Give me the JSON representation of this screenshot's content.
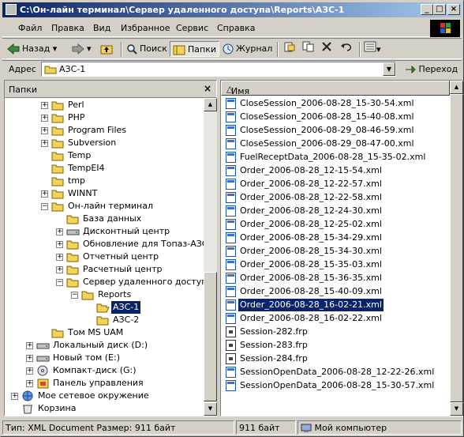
{
  "window": {
    "title": "C:\\Он-лайн терминал\\Сервер удаленного доступа\\Reports\\АЗС-1",
    "minimize": "_",
    "maximize": "□",
    "close": "×"
  },
  "menu": {
    "items": [
      "Файл",
      "Правка",
      "Вид",
      "Избранное",
      "Сервис",
      "Справка"
    ]
  },
  "toolbar": {
    "back": "Назад",
    "forward": "",
    "search": "Поиск",
    "folders": "Папки",
    "history": "Журнал"
  },
  "address": {
    "label": "Адрес",
    "value": "АЗС-1",
    "go": "Переход"
  },
  "folders_pane": {
    "title": "Папки",
    "close": "×",
    "tree": [
      {
        "label": "Perl",
        "level": 3,
        "expander": "+"
      },
      {
        "label": "PHP",
        "level": 3,
        "expander": "+"
      },
      {
        "label": "Program Files",
        "level": 3,
        "expander": "+"
      },
      {
        "label": "Subversion",
        "level": 3,
        "expander": "+"
      },
      {
        "label": "Temp",
        "level": 3,
        "expander": ""
      },
      {
        "label": "TempEI4",
        "level": 3,
        "expander": ""
      },
      {
        "label": "tmp",
        "level": 3,
        "expander": ""
      },
      {
        "label": "WINNT",
        "level": 3,
        "expander": "+"
      },
      {
        "label": "Он-лайн терминал",
        "level": 3,
        "expander": "-"
      },
      {
        "label": "База данных",
        "level": 4,
        "expander": ""
      },
      {
        "label": "Дисконтный центр",
        "level": 4,
        "expander": "+"
      },
      {
        "label": "Обновление для Топаз-АЗС",
        "level": 4,
        "expander": "+"
      },
      {
        "label": "Отчетный центр",
        "level": 4,
        "expander": "+"
      },
      {
        "label": "Расчетный центр",
        "level": 4,
        "expander": "+"
      },
      {
        "label": "Сервер удаленного доступа",
        "level": 4,
        "expander": "-"
      },
      {
        "label": "Reports",
        "level": 5,
        "expander": "-"
      },
      {
        "label": "АЗС-1",
        "level": 6,
        "expander": ""
      },
      {
        "label": "АЗС-2",
        "level": 6,
        "expander": ""
      },
      {
        "label": "Том MS UAM",
        "level": 3,
        "expander": ""
      },
      {
        "label": "Локальный диск (D:)",
        "level": 2,
        "expander": "+"
      },
      {
        "label": "Новый том (E:)",
        "level": 2,
        "expander": "+"
      },
      {
        "label": "Компакт-диск (G:)",
        "level": 2,
        "expander": "+"
      },
      {
        "label": "Панель управления",
        "level": 2,
        "expander": "+"
      },
      {
        "label": "Мое сетевое окружение",
        "level": 1,
        "expander": "+"
      },
      {
        "label": "Корзина",
        "level": 1,
        "expander": ""
      }
    ],
    "selected": "АЗС-1"
  },
  "file_list": {
    "column_name": "Имя",
    "files": [
      {
        "name": "CloseSession_2006-08-28_15-30-54.xml",
        "type": "xml"
      },
      {
        "name": "CloseSession_2006-08-28_15-40-08.xml",
        "type": "xml"
      },
      {
        "name": "CloseSession_2006-08-29_08-46-59.xml",
        "type": "xml"
      },
      {
        "name": "CloseSession_2006-08-29_08-47-00.xml",
        "type": "xml"
      },
      {
        "name": "FuelReceptData_2006-08-28_15-35-02.xml",
        "type": "xml"
      },
      {
        "name": "Order_2006-08-28_12-15-54.xml",
        "type": "xml"
      },
      {
        "name": "Order_2006-08-28_12-22-57.xml",
        "type": "xml"
      },
      {
        "name": "Order_2006-08-28_12-22-58.xml",
        "type": "xml"
      },
      {
        "name": "Order_2006-08-28_12-24-30.xml",
        "type": "xml"
      },
      {
        "name": "Order_2006-08-28_12-25-02.xml",
        "type": "xml"
      },
      {
        "name": "Order_2006-08-28_15-34-29.xml",
        "type": "xml"
      },
      {
        "name": "Order_2006-08-28_15-34-30.xml",
        "type": "xml"
      },
      {
        "name": "Order_2006-08-28_15-35-03.xml",
        "type": "xml"
      },
      {
        "name": "Order_2006-08-28_15-36-35.xml",
        "type": "xml"
      },
      {
        "name": "Order_2006-08-28_15-40-09.xml",
        "type": "xml"
      },
      {
        "name": "Order_2006-08-28_16-02-21.xml",
        "type": "xml"
      },
      {
        "name": "Order_2006-08-28_16-02-22.xml",
        "type": "xml"
      },
      {
        "name": "Session-282.frp",
        "type": "frp"
      },
      {
        "name": "Session-283.frp",
        "type": "frp"
      },
      {
        "name": "Session-284.frp",
        "type": "frp"
      },
      {
        "name": "SessionOpenData_2006-08-28_12-22-26.xml",
        "type": "xml"
      },
      {
        "name": "SessionOpenData_2006-08-28_15-30-57.xml",
        "type": "xml"
      }
    ],
    "selected": "Order_2006-08-28_16-02-21.xml"
  },
  "status": {
    "info": "Тип: XML Document Размер: 911 байт",
    "size": "911 байт",
    "zone": "Мой компьютер"
  },
  "colors": {
    "selection": "#0a246a",
    "folder": "#f3d35b",
    "titlebar_start": "#0a246a",
    "titlebar_end": "#a6caf0"
  }
}
